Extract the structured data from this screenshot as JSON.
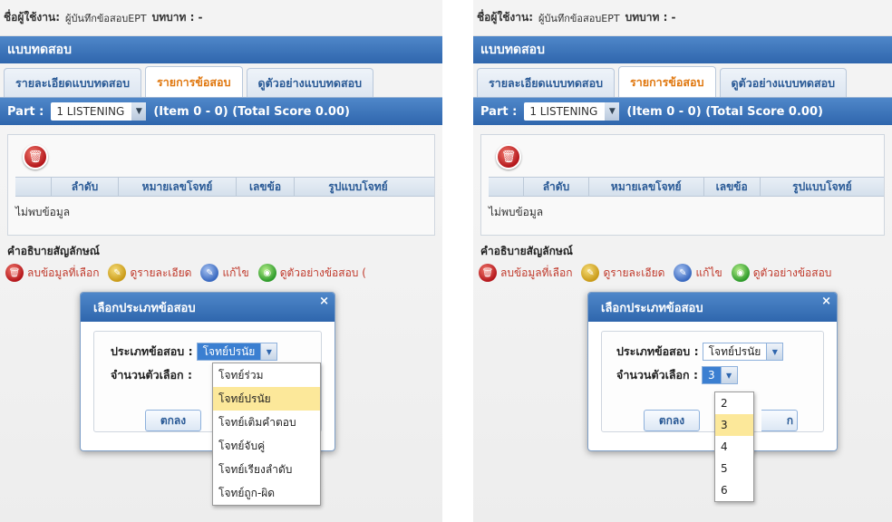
{
  "header": {
    "user_label": "ชื่อผู้ใช้งาน:",
    "user_value": "ผู้บันทึกข้อสอบEPT",
    "role_label": "บทบาท : -"
  },
  "title": "แบบทดสอบ",
  "tabs": [
    {
      "label": "รายละเอียดแบบทดสอบ"
    },
    {
      "label": "รายการข้อสอบ"
    },
    {
      "label": "ดูตัวอย่างแบบทดสอบ"
    }
  ],
  "part": {
    "label": "Part :",
    "selected": "1 LISTENING",
    "info": "(Item 0 - 0) (Total Score 0.00)"
  },
  "grid": {
    "columns": [
      "ลำดับ",
      "หมายเลขโจทย์",
      "เลขข้อ",
      "รูปแบบโจทย์"
    ],
    "empty_text": "ไม่พบข้อมูล"
  },
  "legend": {
    "title": "คำอธิบายสัญลักษณ์",
    "delete": "ลบข้อมูลที่เลือก",
    "detail": "ดูรายละเอียด",
    "edit": "แก้ไข",
    "view_left": "ดูตัวอย่างข้อสอบ (",
    "view_right": "ดูตัวอย่างข้อสอบ"
  },
  "dialog": {
    "title": "เลือกประเภทข้อสอบ",
    "close": "×",
    "type_label": "ประเภทข้อสอบ :",
    "type_value": "โจทย์ปรนัย",
    "count_label": "จำนวนตัวเลือก :",
    "count_value": "3",
    "ok": "ตกลง",
    "cancel_fragment_right": "ก"
  },
  "type_options": [
    "โจทย์ร่วม",
    "โจทย์ปรนัย",
    "โจทย์เติมคำตอบ",
    "โจทย์จับคู่",
    "โจทย์เรียงลำดับ",
    "โจทย์ถูก-ผิด"
  ],
  "count_options": [
    "2",
    "3",
    "4",
    "5",
    "6"
  ],
  "colors": {
    "header_blue": "#2f66ad",
    "active_tab": "#e0770e",
    "highlight": "#fce89a"
  }
}
